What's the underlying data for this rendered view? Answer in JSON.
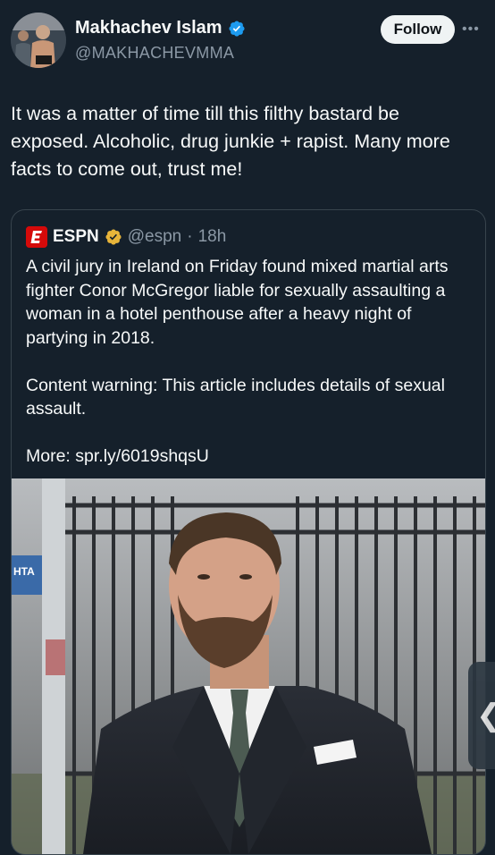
{
  "author": {
    "name": "Makhachev Islam",
    "handle": "@MAKHACHEVMMA",
    "verified_color": "#1d9bf0"
  },
  "follow_label": "Follow",
  "more_label": "•••",
  "tweet_text": "It was a matter of time till this filthy bastard be exposed. Alcoholic, drug junkie + rapist. Many more facts to come out, trust me!",
  "quote": {
    "name": "ESPN",
    "handle": "@espn",
    "separator": "·",
    "time": "18h",
    "badge_color": "#e8b53a",
    "paragraphs": [
      "A civil jury in Ireland on Friday found mixed martial arts fighter Conor McGregor liable for sexually assaulting a woman in a hotel penthouse after a heavy night of partying in 2018.",
      "Content warning: This article includes details of sexual assault.",
      "More: spr.ly/6019shqsU"
    ]
  },
  "photo_sign_text": "HTA",
  "side_tab_glyph": "❮"
}
